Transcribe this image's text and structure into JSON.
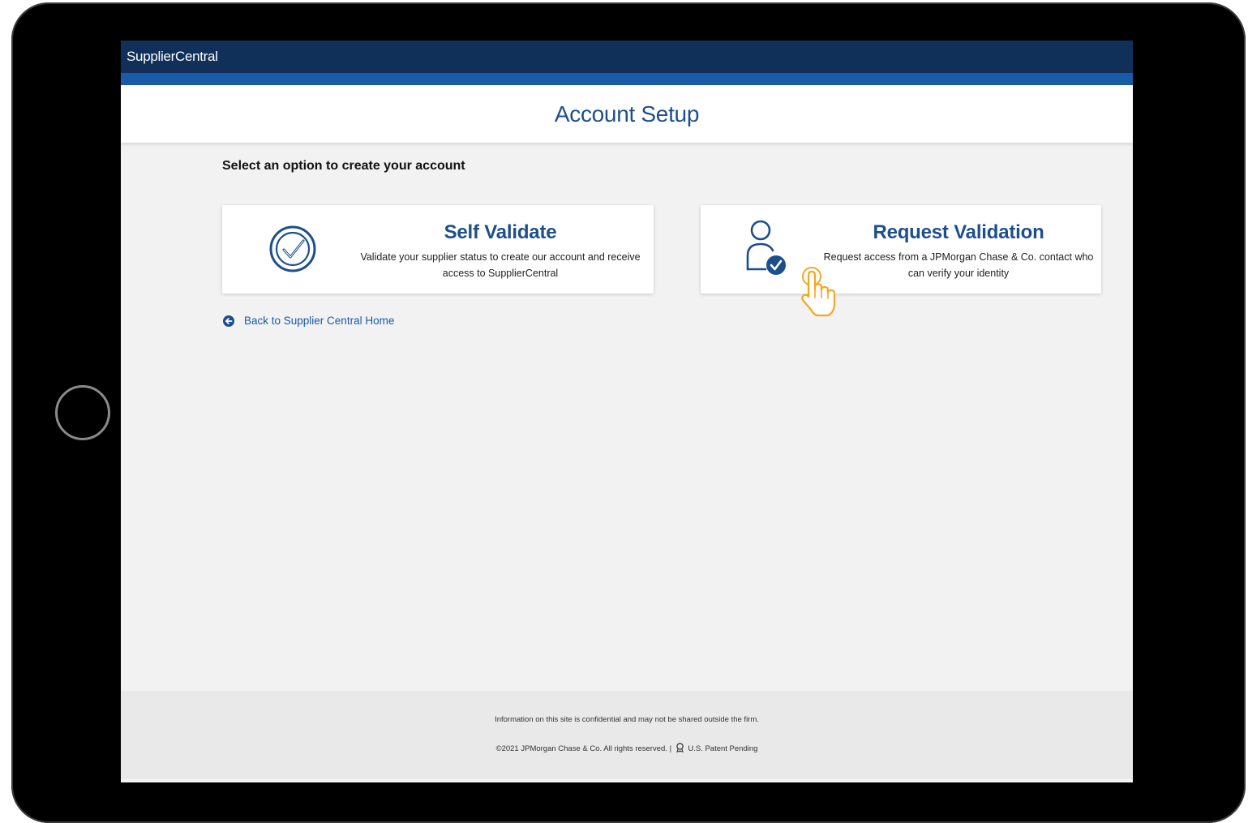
{
  "app": {
    "name": "SupplierCentral"
  },
  "header": {
    "title": "Account Setup"
  },
  "main": {
    "instruction": "Select an option to create your account",
    "options": [
      {
        "title": "Self Validate",
        "description": "Validate your supplier status to create our account and receive access to SupplierCentral",
        "icon": "check-circle-icon"
      },
      {
        "title": "Request Validation",
        "description": "Request access from a JPMorgan Chase & Co. contact who can verify your identity",
        "icon": "user-check-icon"
      }
    ],
    "back_link": "Back to Supplier Central Home"
  },
  "footer": {
    "notice": "Information on this site is confidential and may not be shared outside the firm.",
    "copyright": "©2021 JPMorgan Chase & Co. All rights reserved. |",
    "patent": "U.S. Patent Pending"
  },
  "colors": {
    "navy": "#102f59",
    "accent_blue": "#1a5ba8",
    "brand_text": "#1c4f8c",
    "cursor_orange": "#f5a623"
  }
}
